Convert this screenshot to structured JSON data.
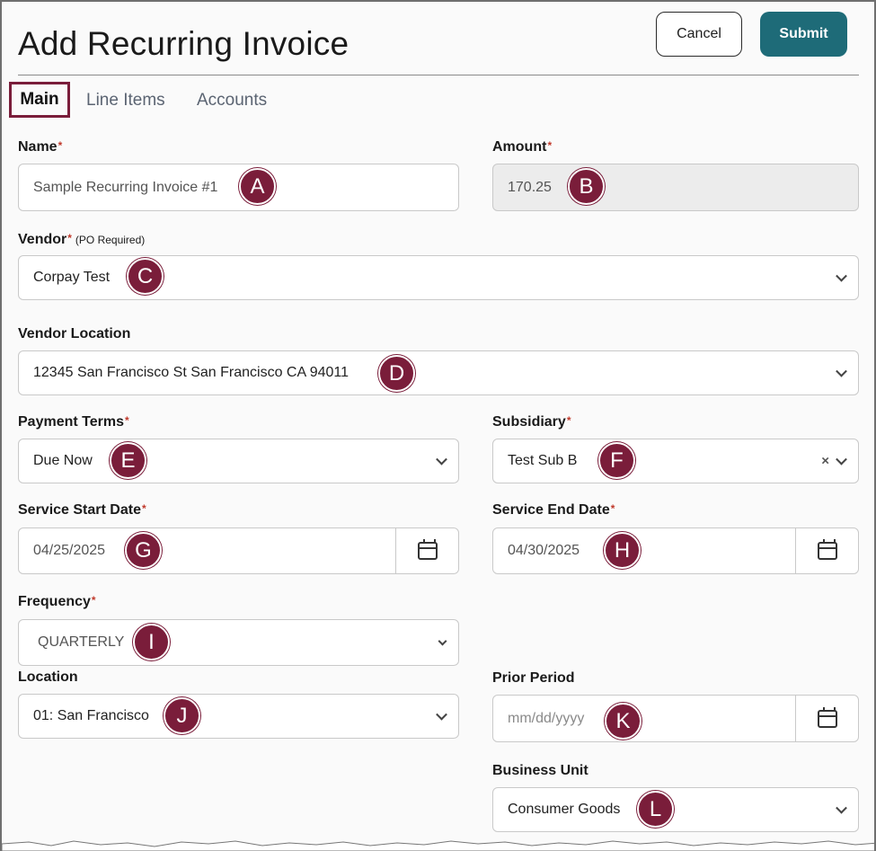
{
  "header": {
    "title": "Add Recurring Invoice",
    "cancel_label": "Cancel",
    "submit_label": "Submit"
  },
  "tabs": [
    {
      "label": "Main",
      "active": true
    },
    {
      "label": "Line Items"
    },
    {
      "label": "Accounts"
    }
  ],
  "required_mark": "*",
  "fields": {
    "name": {
      "label": "Name",
      "value": "Sample Recurring Invoice #1",
      "marker": "A"
    },
    "amount": {
      "label": "Amount",
      "value": "170.25",
      "marker": "B"
    },
    "vendor": {
      "label": "Vendor",
      "note": "(PO Required)",
      "value": "Corpay Test",
      "marker": "C"
    },
    "vendor_location": {
      "label": "Vendor Location",
      "value": "12345 San Francisco St San Francisco CA 94011",
      "marker": "D"
    },
    "payment_terms": {
      "label": "Payment Terms",
      "value": "Due Now",
      "marker": "E"
    },
    "subsidiary": {
      "label": "Subsidiary",
      "value": "Test Sub B",
      "clear": "×",
      "marker": "F"
    },
    "service_start": {
      "label": "Service Start Date",
      "value": "04/25/2025",
      "marker": "G"
    },
    "service_end": {
      "label": "Service End Date",
      "value": "04/30/2025",
      "marker": "H"
    },
    "frequency": {
      "label": "Frequency",
      "value": "QUARTERLY",
      "marker": "I"
    },
    "location": {
      "label": "Location",
      "value": "01: San Francisco",
      "marker": "J"
    },
    "prior_period": {
      "label": "Prior Period",
      "placeholder": "mm/dd/yyyy",
      "marker": "K"
    },
    "business_unit": {
      "label": "Business Unit",
      "value": "Consumer Goods",
      "marker": "L"
    }
  },
  "colors": {
    "accent": "#1e6b78",
    "marker": "#7a1d3a",
    "required": "#c0392b"
  }
}
